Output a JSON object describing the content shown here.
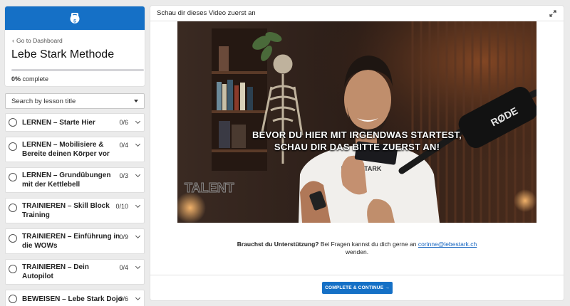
{
  "course": {
    "back_link": "Go to Dashboard",
    "title": "Lebe Stark Methode",
    "progress_percent": 0,
    "progress_value": "0%",
    "progress_label": "complete"
  },
  "search": {
    "placeholder": "Search by lesson title"
  },
  "lessons": [
    {
      "title_line1": "LERNEN – Starte Hier",
      "title_line2": "",
      "count": "0/6"
    },
    {
      "title_line1": "LERNEN – Mobilisiere &",
      "title_line2": "Bereite deinen Körper vor",
      "count": "0/4"
    },
    {
      "title_line1": "LERNEN – Grundübungen",
      "title_line2": "mit der Kettlebell",
      "count": "0/3"
    },
    {
      "title_line1": "TRAINIEREN – Skill Block",
      "title_line2": "Training",
      "count": "0/10"
    },
    {
      "title_line1": "TRAINIEREN – Einführung in",
      "title_line2": "die WOWs",
      "count": "0/9"
    },
    {
      "title_line1": "TRAINIEREN – Dein",
      "title_line2": "Autopilot",
      "count": "0/4"
    },
    {
      "title_line1": "BEWEISEN – Lebe Stark Dojo",
      "title_line2": "",
      "count": "0/6"
    }
  ],
  "main": {
    "header_title": "Schau dir dieses Video zuerst an",
    "video": {
      "caption_line1": "BEVOR DU HIER MIT IRGENDWAS STARTEST,",
      "caption_line2": "SCHAU DIR DAS BITTE ZUERST AN!",
      "mic_brand": "RØDE",
      "shirt_text": "LEBE STARK",
      "neon_text": "TALENT"
    },
    "support": {
      "bold": "Brauchst du Unterstützung?",
      "text": " Bei Fragen kannst du dich gerne an ",
      "email": "corinne@lebestark.ch",
      "tail": "wenden."
    },
    "cta_label": "COMPLETE & CONTINUE →"
  },
  "colors": {
    "accent": "#1570c6",
    "link": "#1565c0"
  }
}
